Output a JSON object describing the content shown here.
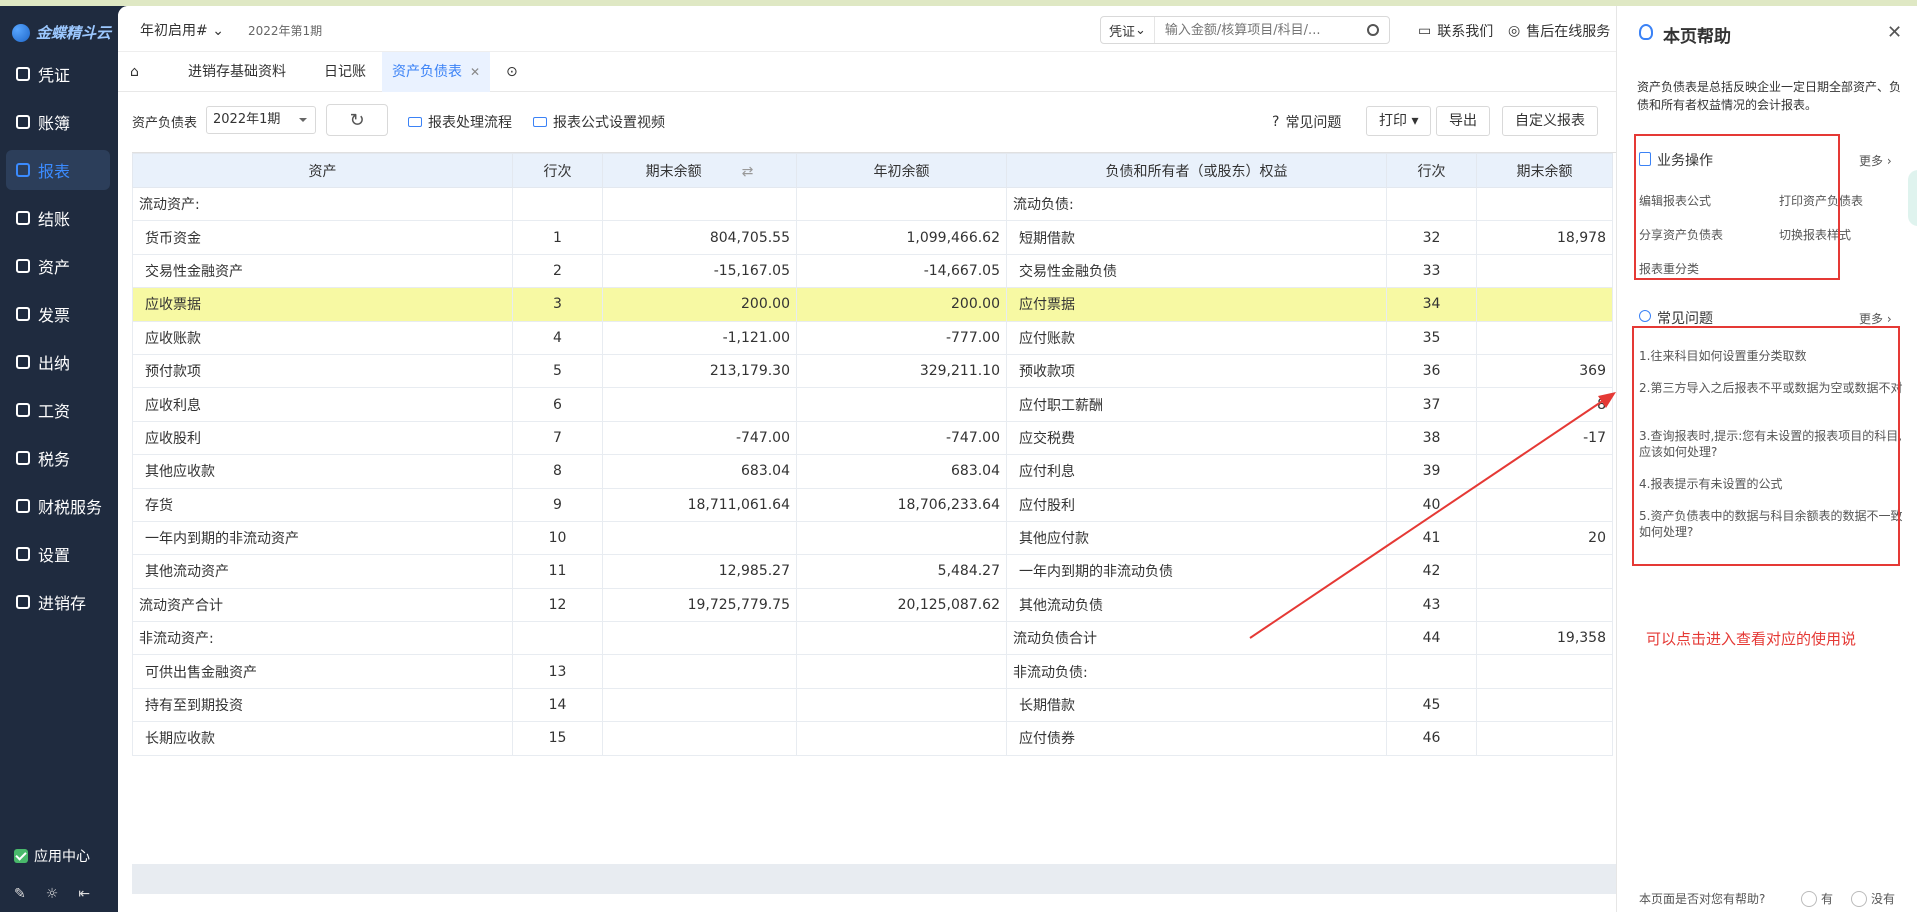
{
  "brand": {
    "name": "金蝶精斗云"
  },
  "sidebar": {
    "items": [
      {
        "label": "凭证",
        "icon": "voucher-icon"
      },
      {
        "label": "账簿",
        "icon": "ledger-icon"
      },
      {
        "label": "报表",
        "icon": "report-icon",
        "active": true
      },
      {
        "label": "结账",
        "icon": "closing-icon"
      },
      {
        "label": "资产",
        "icon": "asset-icon"
      },
      {
        "label": "发票",
        "icon": "invoice-icon"
      },
      {
        "label": "出纳",
        "icon": "cashier-icon"
      },
      {
        "label": "工资",
        "icon": "salary-icon"
      },
      {
        "label": "税务",
        "icon": "tax-icon"
      },
      {
        "label": "财税服务",
        "icon": "finance-service-icon"
      },
      {
        "label": "设置",
        "icon": "settings-icon"
      },
      {
        "label": "进销存",
        "icon": "inventory-icon"
      }
    ],
    "app_center": "应用中心"
  },
  "header": {
    "account": "年初启用#",
    "period": "2022年第1期",
    "search_type": "凭证",
    "search_placeholder": "输入金额/核算项目/科目/...",
    "contact": "联系我们",
    "service": "售后在线服务"
  },
  "tabs": [
    {
      "label": "进销存基础资料"
    },
    {
      "label": "日记账"
    },
    {
      "label": "资产负债表",
      "active": true
    }
  ],
  "toolbar": {
    "report_label": "资产负债表",
    "period_value": "2022年1期",
    "flow_link": "报表处理流程",
    "formula_video": "报表公式设置视频",
    "faq": "常见问题",
    "print": "打印",
    "export": "导出",
    "custom": "自定义报表"
  },
  "table": {
    "headers": [
      "资产",
      "行次",
      "期末余额",
      "年初余额",
      "负债和所有者（或股东）权益",
      "行次",
      "期末余额"
    ],
    "rows": [
      [
        "流动资产:",
        "",
        "",
        "",
        "流动负债:",
        "",
        ""
      ],
      [
        "货币资金",
        "1",
        "804,705.55",
        "1,099,466.62",
        "短期借款",
        "32",
        "18,978"
      ],
      [
        "交易性金融资产",
        "2",
        "-15,167.05",
        "-14,667.05",
        "交易性金融负债",
        "33",
        ""
      ],
      [
        "应收票据",
        "3",
        "200.00",
        "200.00",
        "应付票据",
        "34",
        ""
      ],
      [
        "应收账款",
        "4",
        "-1,121.00",
        "-777.00",
        "应付账款",
        "35",
        ""
      ],
      [
        "预付款项",
        "5",
        "213,179.30",
        "329,211.10",
        "预收款项",
        "36",
        "369"
      ],
      [
        "应收利息",
        "6",
        "",
        "",
        "应付职工薪酬",
        "37",
        "8"
      ],
      [
        "应收股利",
        "7",
        "-747.00",
        "-747.00",
        "应交税费",
        "38",
        "-17"
      ],
      [
        "其他应收款",
        "8",
        "683.04",
        "683.04",
        "应付利息",
        "39",
        ""
      ],
      [
        "存货",
        "9",
        "18,711,061.64",
        "18,706,233.64",
        "应付股利",
        "40",
        ""
      ],
      [
        "一年内到期的非流动资产",
        "10",
        "",
        "",
        "其他应付款",
        "41",
        "20"
      ],
      [
        "其他流动资产",
        "11",
        "12,985.27",
        "5,484.27",
        "一年内到期的非流动负债",
        "42",
        ""
      ],
      [
        "流动资产合计",
        "12",
        "19,725,779.75",
        "20,125,087.62",
        "其他流动负债",
        "43",
        ""
      ],
      [
        "非流动资产:",
        "",
        "",
        "",
        "流动负债合计",
        "44",
        "19,358"
      ],
      [
        "可供出售金融资产",
        "13",
        "",
        "",
        "非流动负债:",
        "",
        ""
      ],
      [
        "持有至到期投资",
        "14",
        "",
        "",
        "长期借款",
        "45",
        ""
      ],
      [
        "长期应收款",
        "15",
        "",
        "",
        "应付债券",
        "46",
        ""
      ]
    ]
  },
  "help": {
    "title": "本页帮助",
    "desc": "资产负债表是总括反映企业一定日期全部资产、负债和所有者权益情况的会计报表。",
    "ops_title": "业务操作",
    "more": "更多",
    "ops": [
      "编辑报表公式",
      "打印资产负债表",
      "分享资产负债表",
      "切换报表样式",
      "报表重分类"
    ],
    "faq_title": "常见问题",
    "faqs": [
      "1.往来科目如何设置重分类取数",
      "2.第三方导入之后报表不平或数据为空或数据不对",
      "3.查询报表时,提示:您有未设置的报表项目的科目,应该如何处理?",
      "4.报表提示有未设置的公式",
      "5.资产负债表中的数据与科目余额表的数据不一致如何处理?"
    ],
    "annotation": "可以点击进入查看对应的使用说",
    "feedback_q": "本页面是否对您有帮助?",
    "yes": "有",
    "no": "没有"
  },
  "colors": {
    "accent": "#3b82f6",
    "highlight_row": "#f7f9a3",
    "annotation": "#e53935",
    "sidebar_bg": "#1f2b3f"
  }
}
